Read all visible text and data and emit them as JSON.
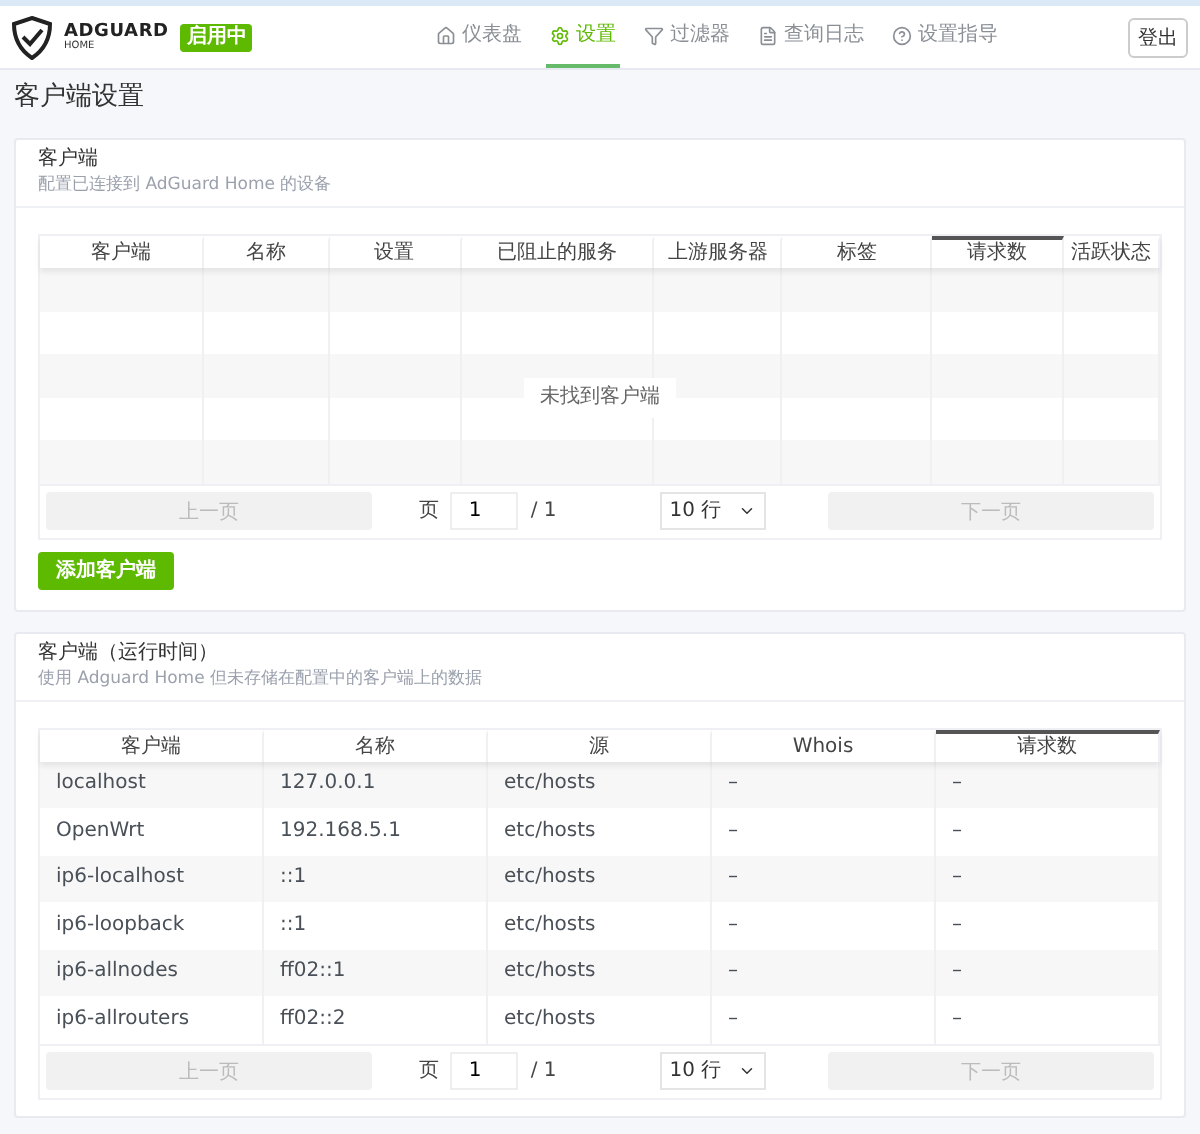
{
  "header": {
    "logo_title": "ADGUARD",
    "logo_subtitle": "HOME",
    "status_badge": "启用中",
    "nav": [
      {
        "label": "仪表盘",
        "selected": false
      },
      {
        "label": "设置",
        "selected": true
      },
      {
        "label": "过滤器",
        "selected": false
      },
      {
        "label": "查询日志",
        "selected": false
      },
      {
        "label": "设置指导",
        "selected": false
      }
    ],
    "logout": "登出"
  },
  "page_title": "客户端设置",
  "clients_card": {
    "title": "客户端",
    "subtitle": "配置已连接到 AdGuard Home 的设备",
    "columns": [
      {
        "label": "客户端",
        "sorted": false
      },
      {
        "label": "名称",
        "sorted": false
      },
      {
        "label": "设置",
        "sorted": false
      },
      {
        "label": "已阻止的服务",
        "sorted": false
      },
      {
        "label": "上游服务器",
        "sorted": false
      },
      {
        "label": "标签",
        "sorted": false
      },
      {
        "label": "请求数",
        "sorted": true
      },
      {
        "label": "活跃状态",
        "sorted": false
      }
    ],
    "empty_message": "未找到客户端",
    "pagination": {
      "prev": "上一页",
      "page_label": "页",
      "page_value": "1",
      "total": "/ 1",
      "rows_select": "10 行",
      "next": "下一页"
    },
    "add_button": "添加客户端"
  },
  "runtime_card": {
    "title": "客户端（运行时间）",
    "subtitle": "使用 Adguard Home 但未存储在配置中的客户端上的数据",
    "columns": [
      {
        "label": "客户端",
        "sorted": false
      },
      {
        "label": "名称",
        "sorted": false
      },
      {
        "label": "源",
        "sorted": false
      },
      {
        "label": "Whois",
        "sorted": false
      },
      {
        "label": "请求数",
        "sorted": true
      }
    ],
    "rows": [
      [
        "localhost",
        "127.0.0.1",
        "etc/hosts",
        "–",
        "–"
      ],
      [
        "OpenWrt",
        "192.168.5.1",
        "etc/hosts",
        "–",
        "–"
      ],
      [
        "ip6-localhost",
        "::1",
        "etc/hosts",
        "–",
        "–"
      ],
      [
        "ip6-loopback",
        "::1",
        "etc/hosts",
        "–",
        "–"
      ],
      [
        "ip6-allnodes",
        "ff02::1",
        "etc/hosts",
        "–",
        "–"
      ],
      [
        "ip6-allrouters",
        "ff02::2",
        "etc/hosts",
        "–",
        "–"
      ]
    ],
    "pagination": {
      "prev": "上一页",
      "page_label": "页",
      "page_value": "1",
      "total": "/ 1",
      "rows_select": "10 行",
      "next": "下一页"
    }
  }
}
